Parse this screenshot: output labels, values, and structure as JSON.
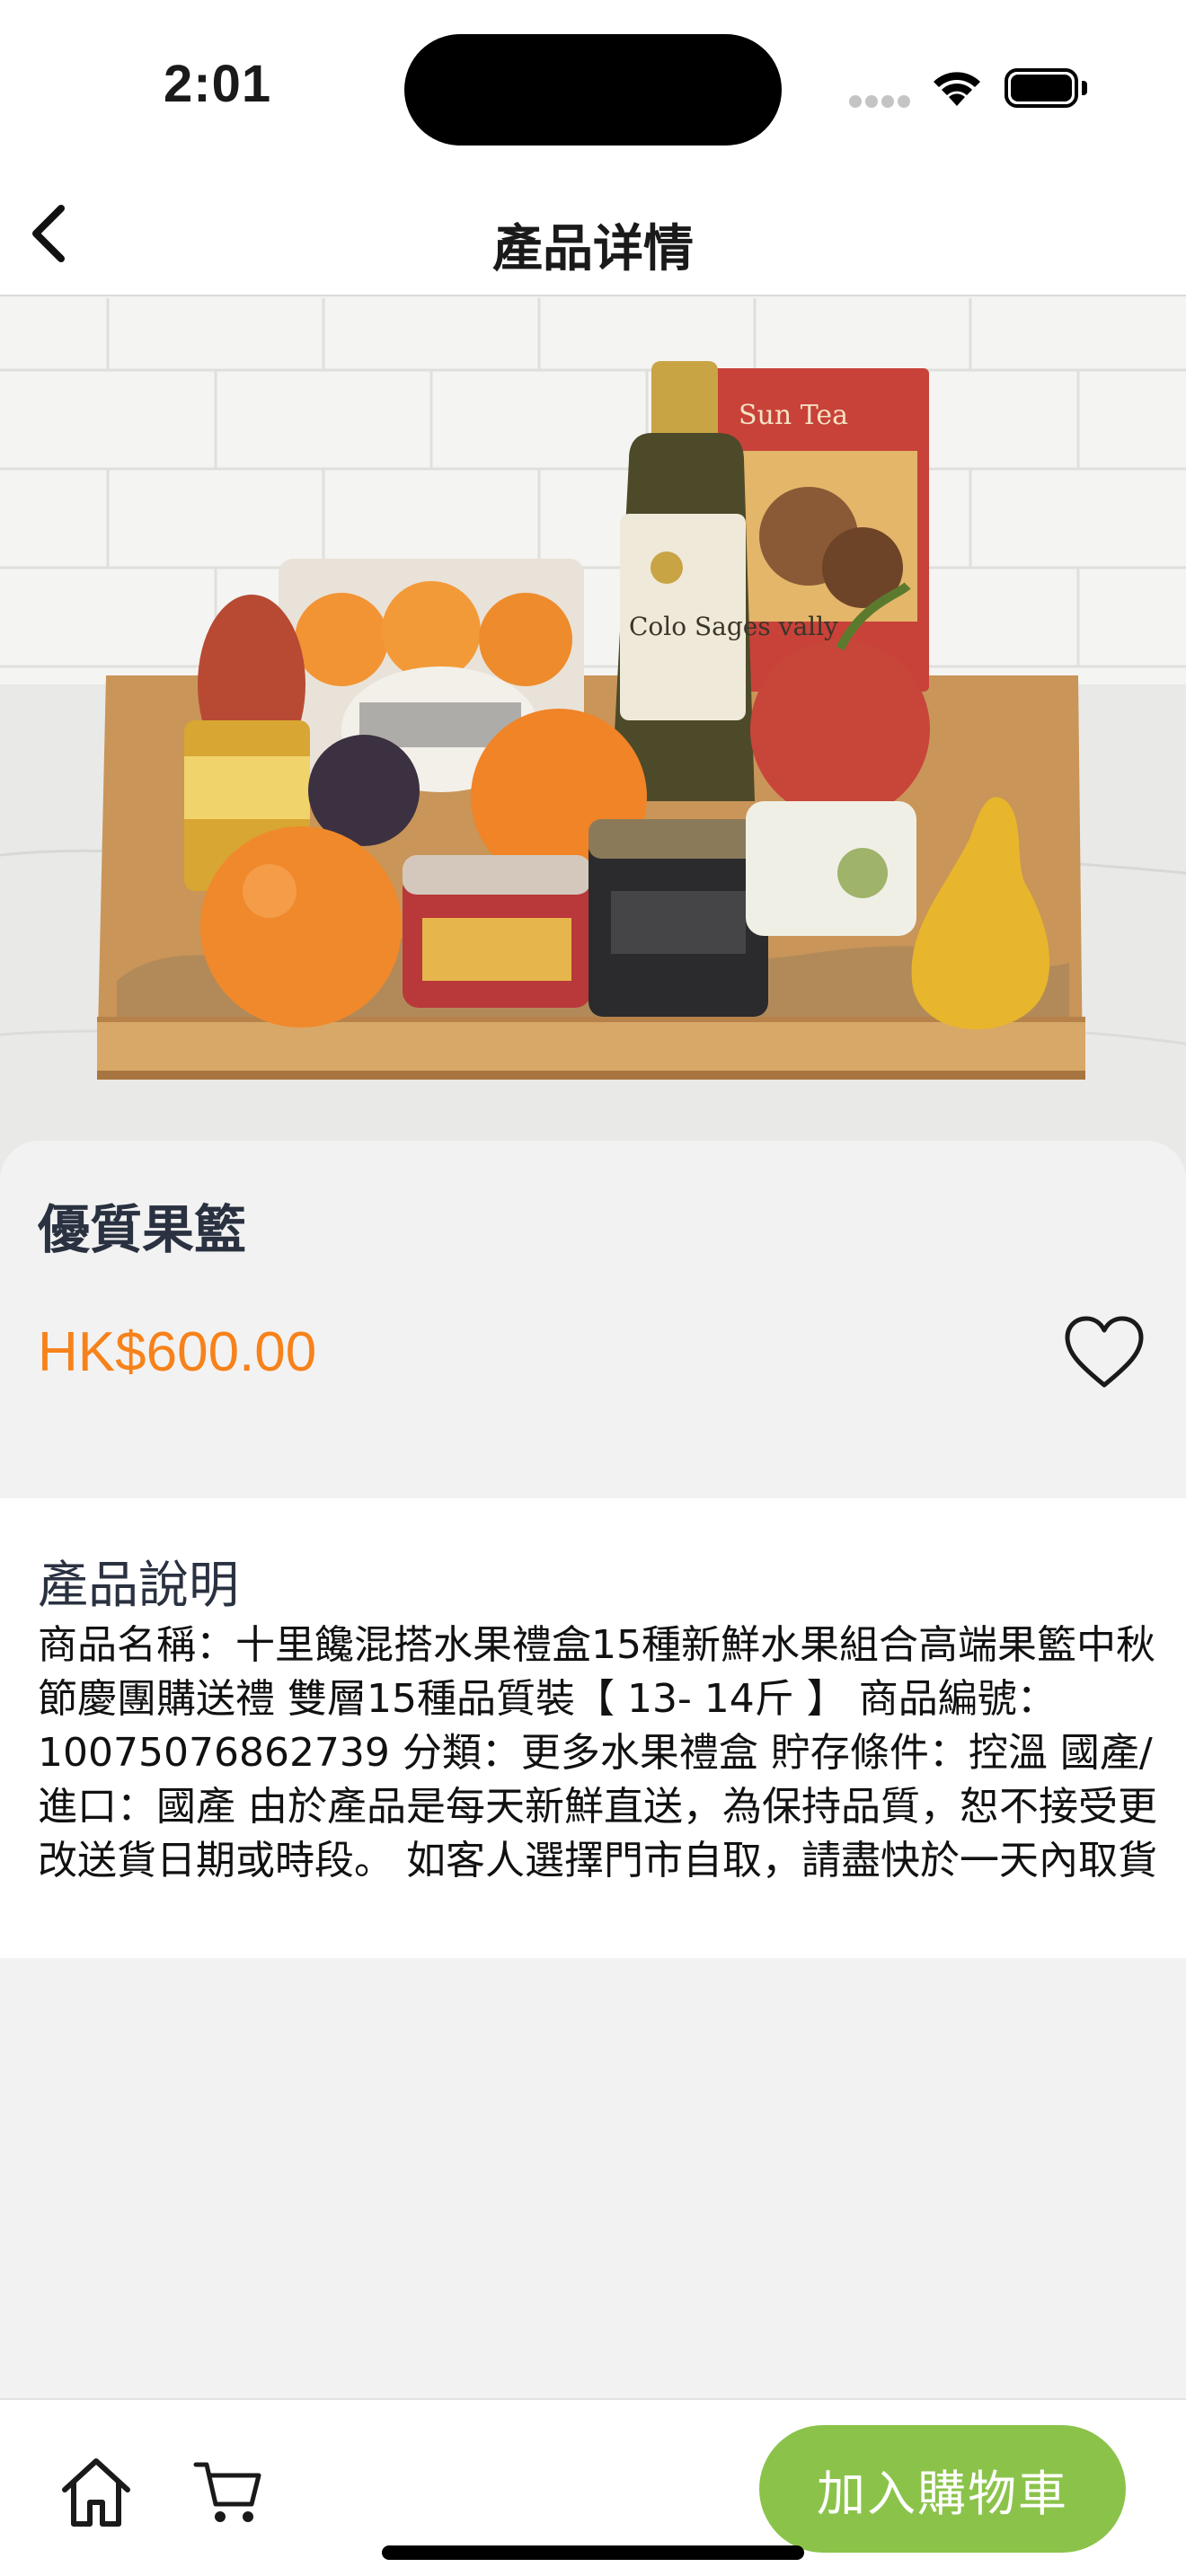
{
  "status_bar": {
    "time": "2:01"
  },
  "nav": {
    "title": "產品详情"
  },
  "product": {
    "name": "優質果籃",
    "price": "HK$600.00",
    "image_labels": {
      "box": "Sun Tea",
      "bottle": "Colo Sages vally"
    }
  },
  "description": {
    "title": "產品說明",
    "body": "商品名稱：十里饞混搭水果禮盒15種新鮮水果組合高端果籃中秋節慶團購送禮 雙層15種品質裝【 13- 14斤 】 商品編號：10075076862739 分類：更多水果禮盒 貯存條件：控溫 國產/進口：國產 由於產品是每天新鮮直送，為保持品質，恕不接受更改送貨日期或時段。 如客人選擇門市自取，請盡快於一天內取貨"
  },
  "bottom_bar": {
    "add_to_cart": "加入購物車"
  },
  "colors": {
    "price": "#f7821b",
    "add_button": "#8bc34a",
    "title_text": "#2a3140"
  }
}
